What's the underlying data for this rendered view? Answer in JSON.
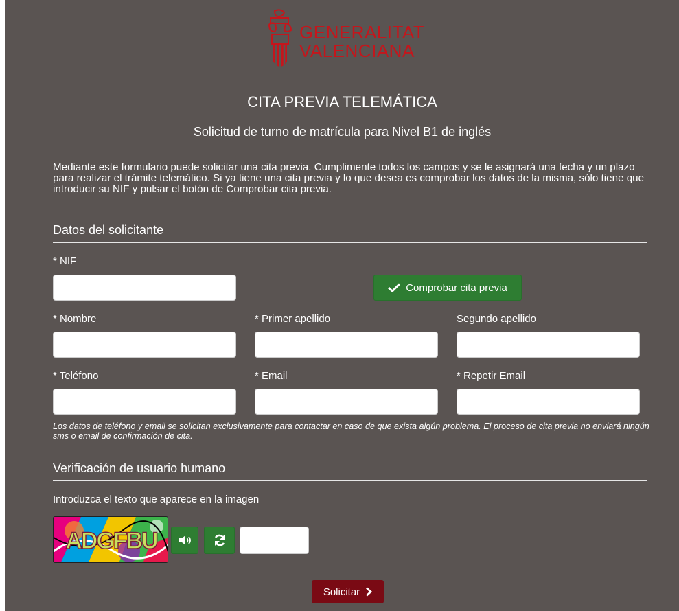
{
  "logo": {
    "line1": "GENERALITAT",
    "line2": "VALENCIANA"
  },
  "header": {
    "title": "CITA PREVIA TELEMÁTICA",
    "subtitle": "Solicitud de turno de matrícula para Nivel B1 de inglés"
  },
  "intro": "Mediante este formulario puede solicitar una cita previa. Cumplimente todos los campos y se le asignará una fecha y un plazo para realizar el trámite telemático. Si ya tiene una cita previa y lo que desea es comprobar los datos de la misma, sólo tiene que introducir su NIF y pulsar el botón de Comprobar cita previa.",
  "applicant": {
    "section_title": "Datos del solicitante",
    "nif_label": "* NIF",
    "check_button": "Comprobar cita previa",
    "nombre_label": "* Nombre",
    "apellido1_label": "* Primer apellido",
    "apellido2_label": "Segundo apellido",
    "telefono_label": "* Teléfono",
    "email_label": "* Email",
    "email2_label": "* Repetir Email",
    "note": "Los datos de teléfono y email se solicitan exclusivamente para contactar en caso de que exista algún problema. El proceso de cita previa no enviará ningún sms o email de confirmación de cita."
  },
  "verification": {
    "section_title": "Verificación de usuario humano",
    "instruction": "Introduzca el texto que aparece en la imagen",
    "captcha_text": "ADGFBU"
  },
  "submit_label": "Solicitar",
  "colors": {
    "panel_bg": "#5a5452",
    "brand_red": "#c4161c",
    "button_green": "#2e7d32",
    "submit_red": "#7a0a14"
  },
  "icons": [
    "checkmark-icon",
    "speaker-icon",
    "refresh-icon",
    "chevron-right-icon"
  ]
}
